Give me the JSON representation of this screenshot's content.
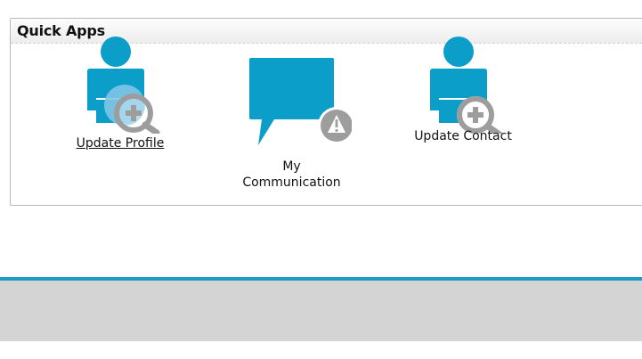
{
  "panel": {
    "title": "Quick Apps"
  },
  "apps": [
    {
      "label": "Update Profile",
      "icon": "person-magnify-plus-icon",
      "state": "hovered"
    },
    {
      "label_line1": "My",
      "label_line2": "Communication",
      "icon": "speech-bubble-alert-icon"
    },
    {
      "label": "Update Contact",
      "icon": "person-magnify-plus-icon"
    }
  ],
  "colors": {
    "icon_blue": "#0a9ec9",
    "badge_gray": "#9d9d9d",
    "footer_accent": "#1f9bc7",
    "footer_bg": "#d4d4d4"
  }
}
